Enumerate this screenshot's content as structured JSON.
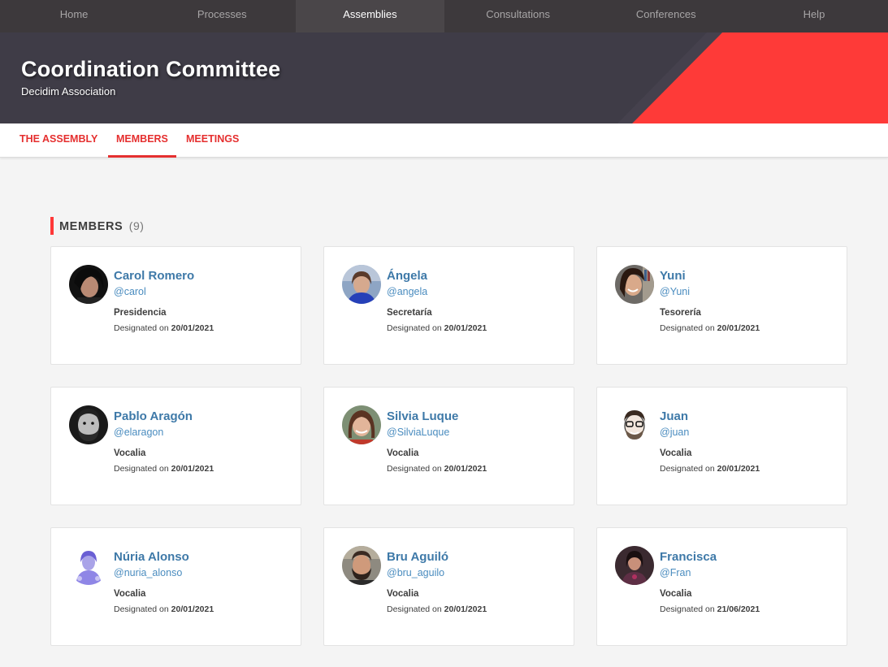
{
  "nav": {
    "items": [
      {
        "label": "Home"
      },
      {
        "label": "Processes"
      },
      {
        "label": "Assemblies"
      },
      {
        "label": "Consultations"
      },
      {
        "label": "Conferences"
      },
      {
        "label": "Help"
      }
    ],
    "active": "Assemblies"
  },
  "hero": {
    "title": "Coordination Committee",
    "subtitle": "Decidim Association"
  },
  "tabs": [
    {
      "label": "THE ASSEMBLY"
    },
    {
      "label": "MEMBERS"
    },
    {
      "label": "MEETINGS"
    }
  ],
  "members_section": {
    "title": "MEMBERS",
    "count": "(9)",
    "designated_prefix": "Designated on",
    "members": [
      {
        "name": "Carol Romero",
        "nickname": "@carol",
        "role": "Presidencia",
        "date": "20/01/2021",
        "avatar": "photo-dark-hair-woman"
      },
      {
        "name": "Ángela",
        "nickname": "@angela",
        "role": "Secretaría",
        "date": "20/01/2021",
        "avatar": "photo-woman-blue"
      },
      {
        "name": "Yuni",
        "nickname": "@Yuni",
        "role": "Tesorería",
        "date": "20/01/2021",
        "avatar": "photo-woman-smiling"
      },
      {
        "name": "Pablo Aragón",
        "nickname": "@elaragon",
        "role": "Vocalia",
        "date": "20/01/2021",
        "avatar": "photo-man-beard-bw"
      },
      {
        "name": "Silvia Luque",
        "nickname": "@SilviaLuque",
        "role": "Vocalia",
        "date": "20/01/2021",
        "avatar": "photo-woman-brown-hair"
      },
      {
        "name": "Juan",
        "nickname": "@juan",
        "role": "Vocalia",
        "date": "20/01/2021",
        "avatar": "illustration-man-glasses"
      },
      {
        "name": "Núria Alonso",
        "nickname": "@nuria_alonso",
        "role": "Vocalia",
        "date": "20/01/2021",
        "avatar": "illustration-woman-purple"
      },
      {
        "name": "Bru Aguiló",
        "nickname": "@bru_aguilo",
        "role": "Vocalia",
        "date": "20/01/2021",
        "avatar": "photo-man-beard"
      },
      {
        "name": "Francisca",
        "nickname": "@Fran",
        "role": "Vocalia",
        "date": "21/06/2021",
        "avatar": "photo-woman-dark"
      }
    ]
  },
  "colors": {
    "accent": "#e52f2f",
    "nav_bg": "#3d393c",
    "hero_bg": "#3f3c47",
    "link": "#3e79a8"
  }
}
